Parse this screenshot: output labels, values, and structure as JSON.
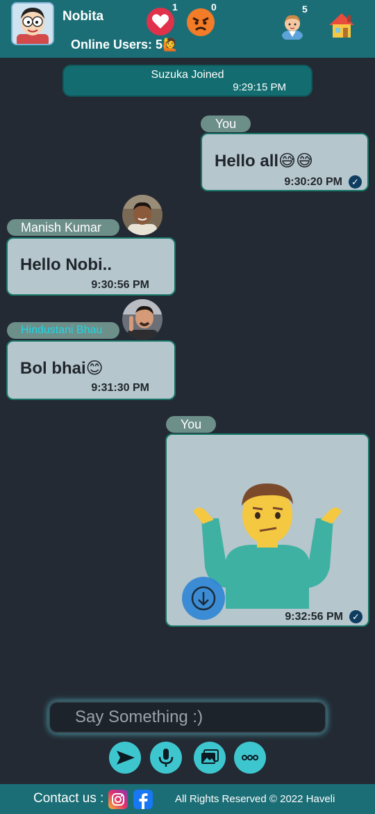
{
  "header": {
    "username": "Nobita",
    "online_label": "Online Users: 5🙋",
    "like_count": "1",
    "angry_count": "0",
    "users_count": "5"
  },
  "messages": {
    "system": {
      "text": "Suzuka Joined",
      "time": "9:29:15 PM"
    },
    "m1": {
      "sender": "You",
      "text": "Hello all😅😅",
      "time": "9:30:20 PM"
    },
    "m2": {
      "sender": "Manish Kumar",
      "text": "Hello Nobi..",
      "time": "9:30:56 PM"
    },
    "m3": {
      "sender": "Hindustani Bhau",
      "text": "Bol bhai😊",
      "time": "9:31:30 PM"
    },
    "m4": {
      "sender": "You",
      "time": "9:32:56 PM"
    }
  },
  "composer": {
    "placeholder": "Say Something :)"
  },
  "footer": {
    "contact": "Contact us :",
    "rights": "All Rights Reserved © 2022 Haveli"
  },
  "icons": {
    "heart": "heart-icon",
    "angry": "angry-face-icon",
    "users": "users-icon",
    "home": "home-icon",
    "send": "send-icon",
    "mic": "microphone-icon",
    "gallery": "gallery-icon",
    "more": "more-icon",
    "download": "download-icon",
    "check": "check-icon",
    "instagram": "instagram-icon",
    "facebook": "facebook-icon"
  },
  "colors": {
    "header": "#1b6e76",
    "background": "#232a33",
    "bubble": "#b5c6cc",
    "accent": "#3ec6cf",
    "sender_highlight": "#1ed7e6"
  }
}
